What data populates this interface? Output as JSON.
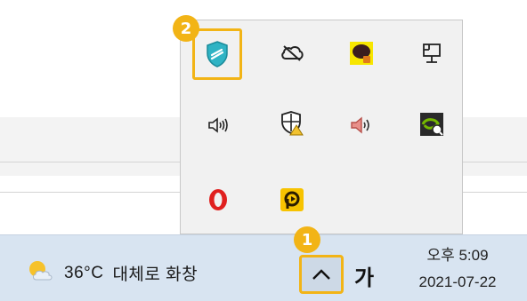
{
  "taskbar": {
    "weather": {
      "temperature": "36°C",
      "condition": "대체로 화창",
      "icon": "partly-sunny-icon"
    },
    "overflow_button": {
      "icon": "chevron-up-icon"
    },
    "ime_indicator": "가",
    "clock": {
      "time": "오후 5:09",
      "date": "2021-07-22"
    }
  },
  "tray_flyout": {
    "icons": [
      {
        "name": "security-shield-icon",
        "highlighted": true
      },
      {
        "name": "cloud-offline-icon"
      },
      {
        "name": "kakaotalk-icon"
      },
      {
        "name": "network-icon"
      },
      {
        "name": "speaker-icon"
      },
      {
        "name": "windows-security-icon"
      },
      {
        "name": "volume-app-icon"
      },
      {
        "name": "nvidia-icon"
      },
      {
        "name": "opera-icon"
      },
      {
        "name": "potplayer-icon"
      }
    ]
  },
  "callouts": [
    "1",
    "2"
  ],
  "colors": {
    "highlight": "#f2b416",
    "taskbar": "#d8e4f1",
    "flyout": "#f1f1f1"
  }
}
